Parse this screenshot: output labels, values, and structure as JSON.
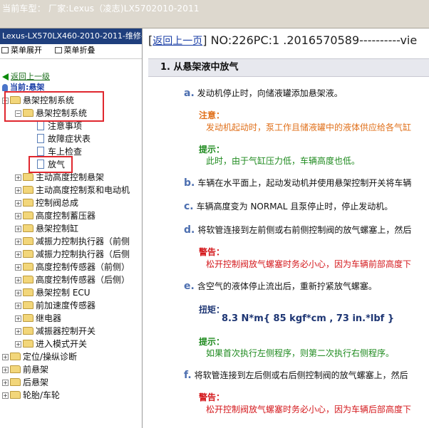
{
  "titlebar": {
    "text": "当前车型： 厂家:Lexus（凌志)LX5702010-2011"
  },
  "left": {
    "header": "Lexus-LX570LX460-2010-2011-维修手册",
    "tools": {
      "expand": "菜单展开",
      "collapse": "菜单折叠"
    },
    "back": "返回上一级",
    "current": "当前:悬架",
    "tree": [
      {
        "label": "悬架控制系统",
        "type": "folder",
        "level": 0,
        "expanded": true
      },
      {
        "label": "悬架控制系统",
        "type": "folder",
        "level": 1,
        "expanded": true
      },
      {
        "label": "注意事项",
        "type": "doc",
        "level": 2
      },
      {
        "label": "故障症状表",
        "type": "doc",
        "level": 2
      },
      {
        "label": "车上检查",
        "type": "doc",
        "level": 2
      },
      {
        "label": "放气",
        "type": "doc",
        "level": 2,
        "selected": true
      },
      {
        "label": "主动高度控制悬架",
        "type": "folder",
        "level": 1
      },
      {
        "label": "主动高度控制泵和电动机",
        "type": "folder",
        "level": 1
      },
      {
        "label": "控制阀总成",
        "type": "folder",
        "level": 1
      },
      {
        "label": "高度控制蓄压器",
        "type": "folder",
        "level": 1
      },
      {
        "label": "悬架控制缸",
        "type": "folder",
        "level": 1
      },
      {
        "label": "减振力控制执行器（前侧",
        "type": "folder",
        "level": 1
      },
      {
        "label": "减振力控制执行器（后侧",
        "type": "folder",
        "level": 1
      },
      {
        "label": "高度控制传感器（前侧）",
        "type": "folder",
        "level": 1
      },
      {
        "label": "高度控制传感器（后侧）",
        "type": "folder",
        "level": 1
      },
      {
        "label": "悬架控制 ECU",
        "type": "folder",
        "level": 1
      },
      {
        "label": "前加速度传感器",
        "type": "folder",
        "level": 1
      },
      {
        "label": "继电器",
        "type": "folder",
        "level": 1
      },
      {
        "label": "减振器控制开关",
        "type": "folder",
        "level": 1
      },
      {
        "label": "进入模式开关",
        "type": "folder",
        "level": 1
      },
      {
        "label": "定位/操纵诊断",
        "type": "folder",
        "level": 0
      },
      {
        "label": "前悬架",
        "type": "folder",
        "level": 0
      },
      {
        "label": "后悬架",
        "type": "folder",
        "level": 0
      },
      {
        "label": "轮胎/车轮",
        "type": "folder",
        "level": 0
      }
    ]
  },
  "right": {
    "nav_link": "返回上一页",
    "nav_text": "NO:226PC:1 .2016570589----------vie",
    "section_title": "1. 从悬架液中放气",
    "a_letter": "a.",
    "a_text": "发动机停止时，向储液罐添加悬架液。",
    "a_note_label": "注意：",
    "a_note_text": "发动机起动时，泵工作且储液罐中的液体供应给各气缸",
    "a_hint_label": "提示：",
    "a_hint_text": "此时，由于气缸压力低，车辆高度也低。",
    "b_letter": "b.",
    "b_text": "车辆在水平面上，起动发动机并使用悬架控制开关将车辆",
    "c_letter": "c.",
    "c_text": "车辆高度变为 NORMAL 且泵停止时，停止发动机。",
    "d_letter": "d.",
    "d_text": "将软管连接到左前侧或右前侧控制阀的放气螺塞上，然后",
    "d_warn_label": "警告：",
    "d_warn_text": "松开控制阀放气螺塞时务必小心，因为车辆前部高度下",
    "e_letter": "e.",
    "e_text": "含空气的液体停止流出后，重新拧紧放气螺塞。",
    "e_torque_label": "扭矩：",
    "e_torque_text": "8.3 N*m{ 85 kgf*cm , 73 in.*lbf }",
    "e_hint_label": "提示：",
    "e_hint_text": "如果首次执行左侧程序，则第二次执行右侧程序。",
    "f_letter": "f.",
    "f_text": "将软管连接到左后侧或右后侧控制阀的放气螺塞上，然后",
    "f_warn_label": "警告：",
    "f_warn_text": "松开控制阀放气螺塞时务必小心，因为车辆后部高度下"
  },
  "colors": {
    "header_bg": "#1f3f7d",
    "highlight": "#e0272e",
    "note": "#e0701b",
    "hint": "#1e8a1e",
    "warn": "#d4181c"
  }
}
